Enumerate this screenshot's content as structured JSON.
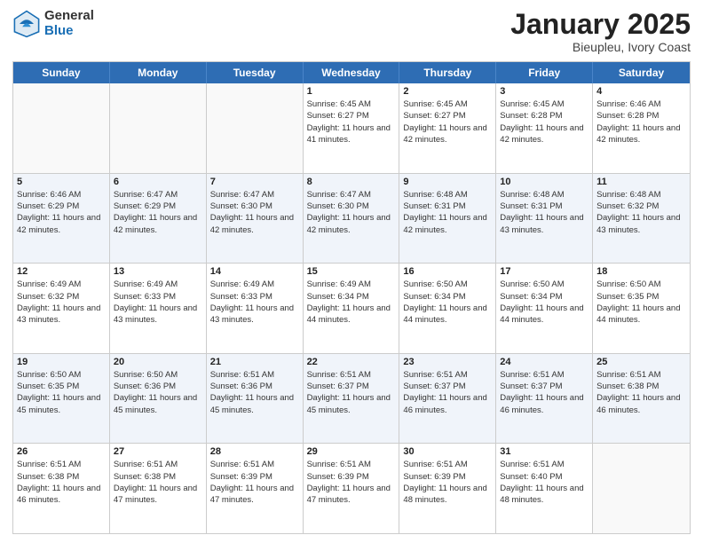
{
  "header": {
    "logo_general": "General",
    "logo_blue": "Blue",
    "title": "January 2025",
    "location": "Bieupleu, Ivory Coast"
  },
  "weekdays": [
    "Sunday",
    "Monday",
    "Tuesday",
    "Wednesday",
    "Thursday",
    "Friday",
    "Saturday"
  ],
  "rows": [
    [
      {
        "day": "",
        "info": ""
      },
      {
        "day": "",
        "info": ""
      },
      {
        "day": "",
        "info": ""
      },
      {
        "day": "1",
        "info": "Sunrise: 6:45 AM\nSunset: 6:27 PM\nDaylight: 11 hours and 41 minutes."
      },
      {
        "day": "2",
        "info": "Sunrise: 6:45 AM\nSunset: 6:27 PM\nDaylight: 11 hours and 42 minutes."
      },
      {
        "day": "3",
        "info": "Sunrise: 6:45 AM\nSunset: 6:28 PM\nDaylight: 11 hours and 42 minutes."
      },
      {
        "day": "4",
        "info": "Sunrise: 6:46 AM\nSunset: 6:28 PM\nDaylight: 11 hours and 42 minutes."
      }
    ],
    [
      {
        "day": "5",
        "info": "Sunrise: 6:46 AM\nSunset: 6:29 PM\nDaylight: 11 hours and 42 minutes."
      },
      {
        "day": "6",
        "info": "Sunrise: 6:47 AM\nSunset: 6:29 PM\nDaylight: 11 hours and 42 minutes."
      },
      {
        "day": "7",
        "info": "Sunrise: 6:47 AM\nSunset: 6:30 PM\nDaylight: 11 hours and 42 minutes."
      },
      {
        "day": "8",
        "info": "Sunrise: 6:47 AM\nSunset: 6:30 PM\nDaylight: 11 hours and 42 minutes."
      },
      {
        "day": "9",
        "info": "Sunrise: 6:48 AM\nSunset: 6:31 PM\nDaylight: 11 hours and 42 minutes."
      },
      {
        "day": "10",
        "info": "Sunrise: 6:48 AM\nSunset: 6:31 PM\nDaylight: 11 hours and 43 minutes."
      },
      {
        "day": "11",
        "info": "Sunrise: 6:48 AM\nSunset: 6:32 PM\nDaylight: 11 hours and 43 minutes."
      }
    ],
    [
      {
        "day": "12",
        "info": "Sunrise: 6:49 AM\nSunset: 6:32 PM\nDaylight: 11 hours and 43 minutes."
      },
      {
        "day": "13",
        "info": "Sunrise: 6:49 AM\nSunset: 6:33 PM\nDaylight: 11 hours and 43 minutes."
      },
      {
        "day": "14",
        "info": "Sunrise: 6:49 AM\nSunset: 6:33 PM\nDaylight: 11 hours and 43 minutes."
      },
      {
        "day": "15",
        "info": "Sunrise: 6:49 AM\nSunset: 6:34 PM\nDaylight: 11 hours and 44 minutes."
      },
      {
        "day": "16",
        "info": "Sunrise: 6:50 AM\nSunset: 6:34 PM\nDaylight: 11 hours and 44 minutes."
      },
      {
        "day": "17",
        "info": "Sunrise: 6:50 AM\nSunset: 6:34 PM\nDaylight: 11 hours and 44 minutes."
      },
      {
        "day": "18",
        "info": "Sunrise: 6:50 AM\nSunset: 6:35 PM\nDaylight: 11 hours and 44 minutes."
      }
    ],
    [
      {
        "day": "19",
        "info": "Sunrise: 6:50 AM\nSunset: 6:35 PM\nDaylight: 11 hours and 45 minutes."
      },
      {
        "day": "20",
        "info": "Sunrise: 6:50 AM\nSunset: 6:36 PM\nDaylight: 11 hours and 45 minutes."
      },
      {
        "day": "21",
        "info": "Sunrise: 6:51 AM\nSunset: 6:36 PM\nDaylight: 11 hours and 45 minutes."
      },
      {
        "day": "22",
        "info": "Sunrise: 6:51 AM\nSunset: 6:37 PM\nDaylight: 11 hours and 45 minutes."
      },
      {
        "day": "23",
        "info": "Sunrise: 6:51 AM\nSunset: 6:37 PM\nDaylight: 11 hours and 46 minutes."
      },
      {
        "day": "24",
        "info": "Sunrise: 6:51 AM\nSunset: 6:37 PM\nDaylight: 11 hours and 46 minutes."
      },
      {
        "day": "25",
        "info": "Sunrise: 6:51 AM\nSunset: 6:38 PM\nDaylight: 11 hours and 46 minutes."
      }
    ],
    [
      {
        "day": "26",
        "info": "Sunrise: 6:51 AM\nSunset: 6:38 PM\nDaylight: 11 hours and 46 minutes."
      },
      {
        "day": "27",
        "info": "Sunrise: 6:51 AM\nSunset: 6:38 PM\nDaylight: 11 hours and 47 minutes."
      },
      {
        "day": "28",
        "info": "Sunrise: 6:51 AM\nSunset: 6:39 PM\nDaylight: 11 hours and 47 minutes."
      },
      {
        "day": "29",
        "info": "Sunrise: 6:51 AM\nSunset: 6:39 PM\nDaylight: 11 hours and 47 minutes."
      },
      {
        "day": "30",
        "info": "Sunrise: 6:51 AM\nSunset: 6:39 PM\nDaylight: 11 hours and 48 minutes."
      },
      {
        "day": "31",
        "info": "Sunrise: 6:51 AM\nSunset: 6:40 PM\nDaylight: 11 hours and 48 minutes."
      },
      {
        "day": "",
        "info": ""
      }
    ]
  ]
}
